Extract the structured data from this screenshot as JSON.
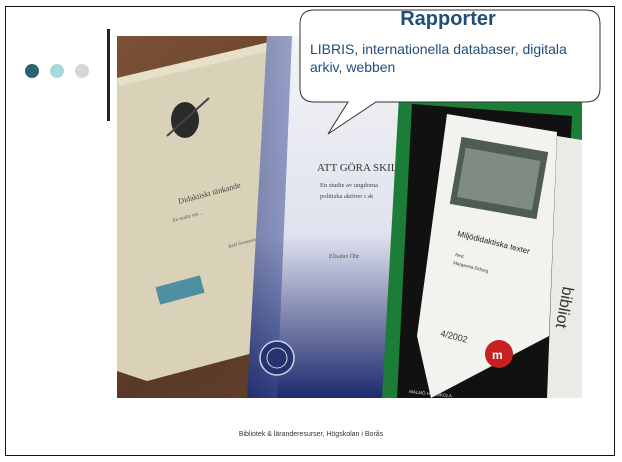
{
  "callout": {
    "title": "Rapporter",
    "body": "LIBRIS, internationella databaser, digitala arkiv, webben"
  },
  "bullets": {
    "colors": [
      "#2a6572",
      "#a8d8dc",
      "#d6d6d6"
    ]
  },
  "footer": "Bibliotek & läranderesurser, Högskolan i Borås",
  "photo": {
    "report_left": {
      "title": "Didaktiskt tänkande",
      "subtitle": "En studie om ...",
      "author": "Rolf Svensson"
    },
    "report_middle": {
      "title": "ATT GÖRA SKILL",
      "line1": "En studie av ungdoma",
      "line2": "politiska aktörer i sk",
      "author": "Elisabet Öhr"
    },
    "report_right": {
      "title": "Miljödidaktiska texter",
      "red": "Red.",
      "editor": "Margareta Ekborg",
      "number": "4/2002",
      "publisher": "MALMÖ HÖGSKOLA",
      "spine": "bibliot"
    }
  }
}
